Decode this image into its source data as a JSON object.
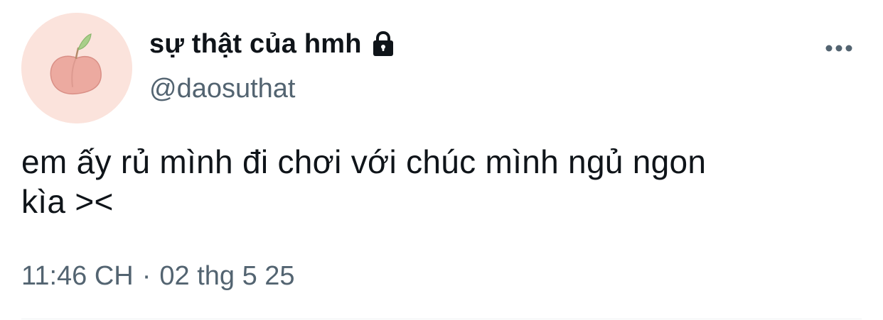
{
  "author": {
    "display_name": "sự thật của hmh",
    "handle": "@daosuthat",
    "avatar_icon": "peach-icon",
    "protected_icon": "lock-icon"
  },
  "tweet": {
    "text": "em ấy rủ mình đi chơi với chúc mình ngủ ngon\nkìa ><",
    "time": "11:46 CH",
    "separator": "·",
    "date": "02 thg 5 25"
  },
  "actions": {
    "more_icon": "more-horizontal-icon"
  },
  "colors": {
    "text_primary": "#0f1419",
    "text_secondary": "#536471",
    "avatar_bg": "#fbe3dc",
    "divider": "#eff3f4"
  }
}
